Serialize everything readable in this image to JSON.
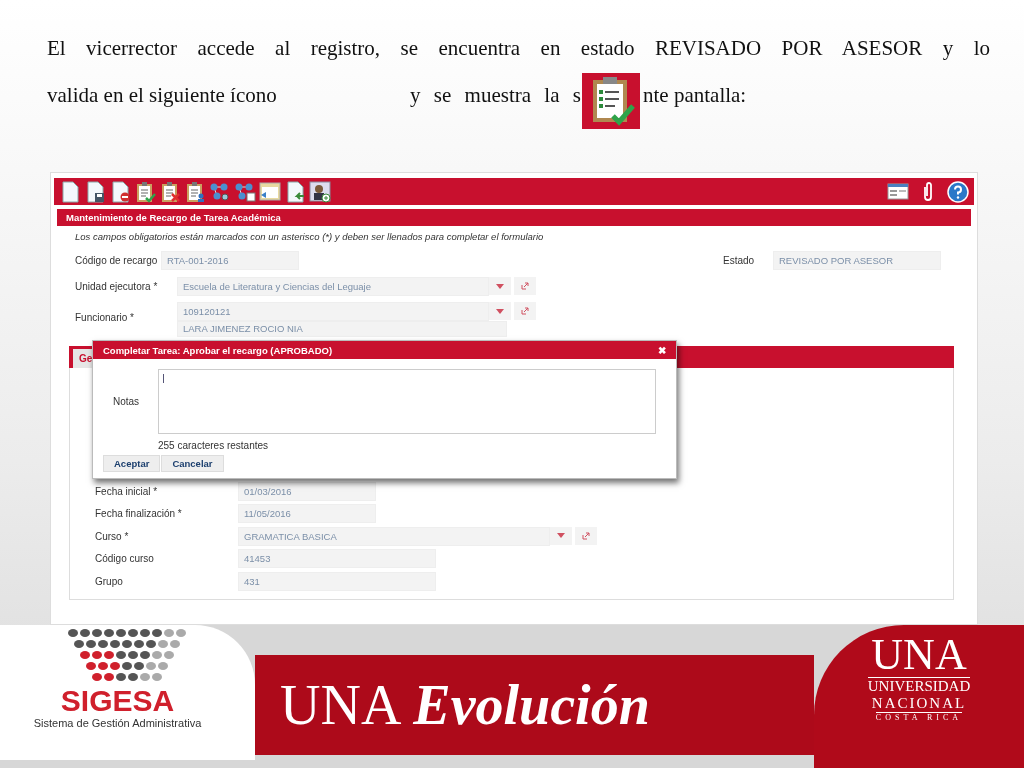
{
  "caption": {
    "line_1": "El vicerrector accede al registro, se encuentra en estado REVISADO POR ASESOR y lo",
    "line_2": "valida en el siguiente ícono",
    "line_3": "y se muestra la s",
    "line_4": "nte pantalla:"
  },
  "app": {
    "form_title": "Mantenimiento de Recargo de Tarea Académica",
    "required_note": "Los campos obligatorios están marcados con un asterisco (*) y deben ser llenados para completar el formulario",
    "fields": [
      {
        "label": "Código de recargo",
        "value": "RTA-001-2016",
        "kind": "text"
      },
      {
        "label": "Estado",
        "value": "REVISADO POR ASESOR",
        "kind": "text"
      },
      {
        "label": "Unidad ejecutora *",
        "value": "Escuela de Literatura y Ciencias del Leguaje",
        "kind": "select"
      },
      {
        "label": "Funcionario *",
        "value": "109120121",
        "value_2": "LARA JIMENEZ ROCIO NIA",
        "kind": "select"
      }
    ],
    "tabs": [
      {
        "label": "Ge",
        "selected": true
      }
    ],
    "panel_fields": [
      {
        "label": "Fecha inicial *",
        "value": "01/03/2016",
        "kind": "date"
      },
      {
        "label": "Fecha finalización *",
        "value": "11/05/2016",
        "kind": "date"
      },
      {
        "label": "Curso *",
        "value": "GRAMATICA BASICA",
        "kind": "select"
      },
      {
        "label": "Código curso",
        "value": "41453",
        "kind": "text"
      },
      {
        "label": "Grupo",
        "value": "431",
        "kind": "text"
      }
    ],
    "dialog": {
      "title": "Completar Tarea: Aprobar el recargo (APROBADO)",
      "close": "✖",
      "notes_label": "Notas",
      "counter": "255 caracteres restantes",
      "buttons": [
        "Aceptar",
        "Cancelar"
      ]
    }
  },
  "footer": {
    "logo_name": "SIGESA",
    "logo_subtitle": "Sistema de Gestión Administrativa",
    "banner_1": "UNA",
    "banner_2": "Evolución",
    "university_1": "UNA",
    "university_2": "UNIVERSIDAD",
    "university_3": "NACIONAL",
    "university_4": "COSTA RICA"
  }
}
